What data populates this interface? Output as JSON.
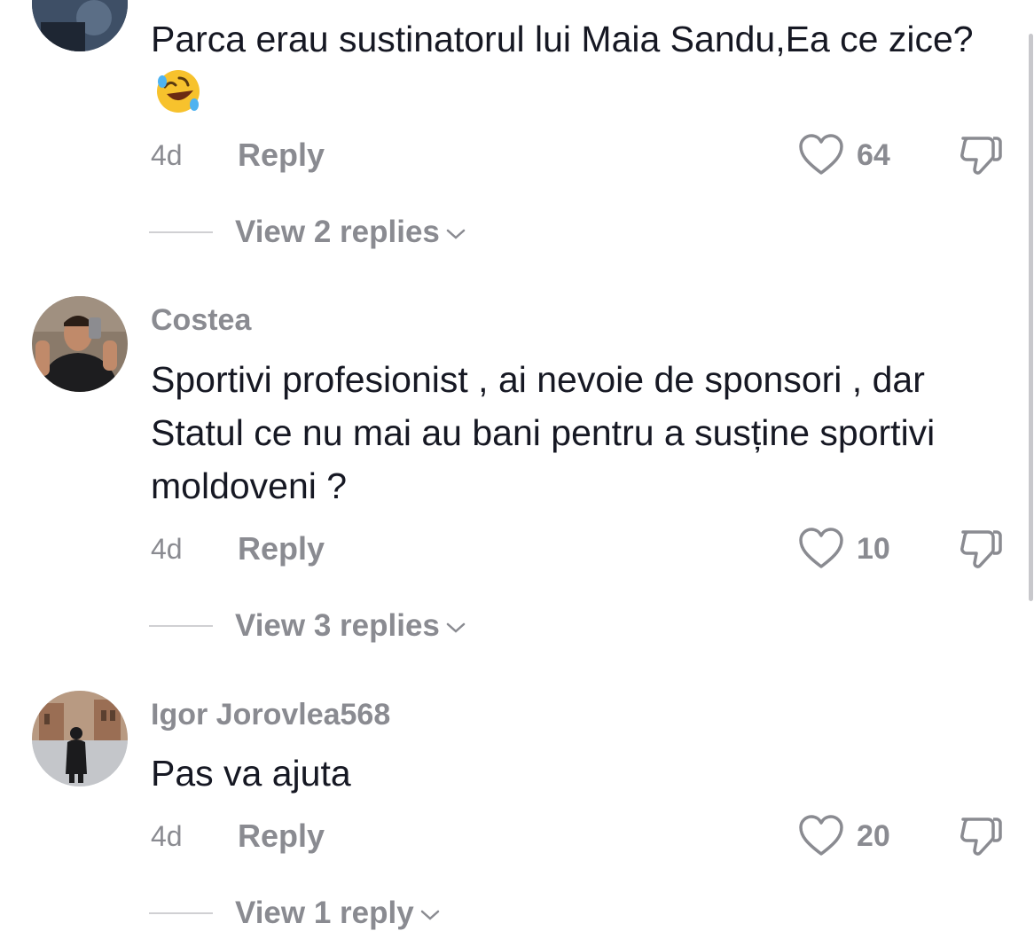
{
  "comments": [
    {
      "username": "",
      "text": "Parca erau sustinatorul lui Maia Sandu,Ea ce zice?",
      "emoji": "rolling-on-floor-laughing-emoji",
      "time": "4d",
      "reply_label": "Reply",
      "likes": "64",
      "view_replies": "View 2 replies"
    },
    {
      "username": "Costea",
      "text": "Sportivi profesionist , ai nevoie de sponsori , dar Statul ce nu mai au bani pentru a susține sportivi moldoveni ?",
      "time": "4d",
      "reply_label": "Reply",
      "likes": "10",
      "view_replies": "View 3 replies"
    },
    {
      "username": "Igor Jorovlea568",
      "text": "Pas va ajuta",
      "time": "4d",
      "reply_label": "Reply",
      "likes": "20",
      "view_replies": "View 1 reply"
    }
  ],
  "icons": {
    "like": "heart-outline-icon",
    "dislike": "thumbs-down-icon",
    "expand": "chevron-down-icon"
  },
  "colors": {
    "text": "#161823",
    "secondary": "#8a8b91",
    "divider": "#d0d0d3"
  }
}
